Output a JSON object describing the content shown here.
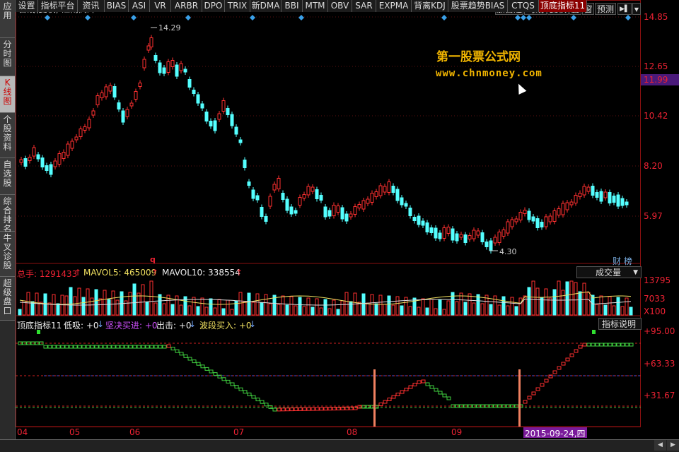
{
  "title": "日线(复权) 江南高纤",
  "sidebar": {
    "items": [
      {
        "label": "应用"
      },
      {
        "label": "分时图"
      },
      {
        "label": "K线图",
        "active": true
      },
      {
        "label": "个股资料"
      },
      {
        "label": "自选股"
      },
      {
        "label": "综合排名"
      },
      {
        "label": "牛叉诊股"
      },
      {
        "label": "超级盘口"
      }
    ]
  },
  "toolbar": {
    "add_fav": "加自选",
    "ma": "均线",
    "adjust": "复权",
    "overlay": "叠",
    "window": "窗",
    "forecast": "预测",
    "arrow": "▶▌",
    "menu": "▼"
  },
  "watermark": {
    "line1": "第一股票公式网",
    "line2": "www.chnmoney.com"
  },
  "price_axis": {
    "ticks": [
      "14.85",
      "12.65",
      "10.42",
      "8.20",
      "5.97"
    ],
    "current": "11.99"
  },
  "annotations": {
    "high": "14.29",
    "low": "4.30",
    "finance": "财 榜",
    "q_marker": "q"
  },
  "volume_panel": {
    "total_label": "总手: 1291433",
    "mavol5_label": "MAVOL5: 465009",
    "mavol10_label": "MAVOL10: 338554",
    "dropdown": "成交量",
    "ticks": [
      "13795",
      "7033",
      "X100"
    ]
  },
  "indicator_panel": {
    "name": "顶底指标11",
    "low_buy": "低吸: +0",
    "firm_buy": "坚决买进: +0",
    "out": "出击: +0",
    "wave_buy": "波段买入: +0",
    "explain_btn": "指标说明",
    "ticks": [
      "+95.00",
      "+63.33",
      "+31.67"
    ]
  },
  "time_axis": {
    "labels": [
      "04",
      "05",
      "06",
      "07",
      "08",
      "09"
    ],
    "highlight": "2015-09-24,四"
  },
  "bottom_tabs": [
    "设置",
    "指标平台",
    "资讯",
    "BIAS",
    "ASI",
    "VR",
    "ARBR",
    "DPO",
    "TRIX",
    "新DMA",
    "BBI",
    "MTM",
    "OBV",
    "SAR",
    "EXPMA",
    "背离KDJ",
    "股票趋势BIAS",
    "CTQS",
    "顶底指标11"
  ],
  "colors": {
    "up": "#ff3030",
    "down": "#54ffff",
    "diamond": "#3aa0e8",
    "accent": "#f0b400"
  }
}
